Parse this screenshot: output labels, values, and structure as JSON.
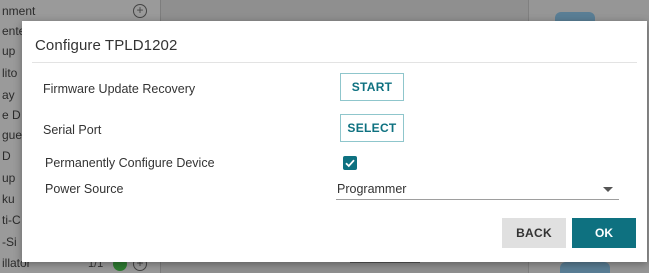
{
  "background": {
    "list_items": [
      "nment",
      "ente",
      "up",
      "lito",
      "ay",
      "e D",
      "gue",
      "D",
      "up",
      "ku",
      "ti-C",
      "-Si",
      "illator"
    ],
    "item_count": "1/1"
  },
  "dialog": {
    "title": "Configure TPLD1202",
    "rows": {
      "firmware": {
        "label": "Firmware Update Recovery",
        "button": "START"
      },
      "serial": {
        "label": "Serial Port",
        "button": "SELECT"
      },
      "permanent": {
        "label": "Permanently Configure Device",
        "checked": true
      },
      "power": {
        "label": "Power Source",
        "value": "Programmer"
      }
    },
    "buttons": {
      "back": "BACK",
      "ok": "OK"
    }
  },
  "colors": {
    "accent": "#0e7180",
    "outline": "#8fc6cc"
  }
}
